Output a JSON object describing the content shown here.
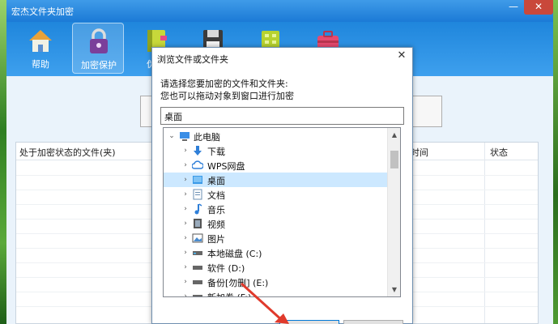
{
  "app": {
    "title": "宏杰文件夹加密",
    "toolbar": [
      {
        "label": "帮助",
        "icon": "home-icon"
      },
      {
        "label": "加密保护",
        "icon": "lock-icon"
      },
      {
        "label": "伪装",
        "icon": "book-icon"
      },
      {
        "label": "",
        "icon": "floppy-disk-icon"
      },
      {
        "label": "",
        "icon": "green-grid-icon"
      },
      {
        "label": "",
        "icon": "toolbox-icon"
      }
    ],
    "table": {
      "columns": [
        "处于加密状态的文件(夹)",
        "时间",
        "状态"
      ]
    }
  },
  "dialog": {
    "title": "浏览文件或文件夹",
    "close": "✕",
    "instruction_line1": "请选择您要加密的文件和文件夹:",
    "instruction_line2": "您也可以拖动对象到窗口进行加密",
    "path_value": "桌面",
    "tree": [
      {
        "label": "此电脑",
        "icon": "computer-icon",
        "expanded": true,
        "level": 0
      },
      {
        "label": "下载",
        "icon": "download-icon",
        "level": 1
      },
      {
        "label": "WPS网盘",
        "icon": "cloud-icon",
        "level": 1
      },
      {
        "label": "桌面",
        "icon": "desktop-icon",
        "level": 1,
        "selected": true
      },
      {
        "label": "文档",
        "icon": "document-icon",
        "level": 1
      },
      {
        "label": "音乐",
        "icon": "music-icon",
        "level": 1
      },
      {
        "label": "视频",
        "icon": "video-icon",
        "level": 1
      },
      {
        "label": "图片",
        "icon": "picture-icon",
        "level": 1
      },
      {
        "label": "本地磁盘 (C:)",
        "icon": "drive-icon",
        "level": 1
      },
      {
        "label": "软件 (D:)",
        "icon": "drive-icon",
        "level": 1
      },
      {
        "label": "备份[勿删] (E:)",
        "icon": "drive-icon",
        "level": 1
      },
      {
        "label": "新加卷 (F:)",
        "icon": "drive-icon",
        "level": 1
      }
    ]
  },
  "colors": {
    "titlebar": "#1b7ad6",
    "selection": "#cce8ff",
    "arrow": "#e03a2c"
  }
}
